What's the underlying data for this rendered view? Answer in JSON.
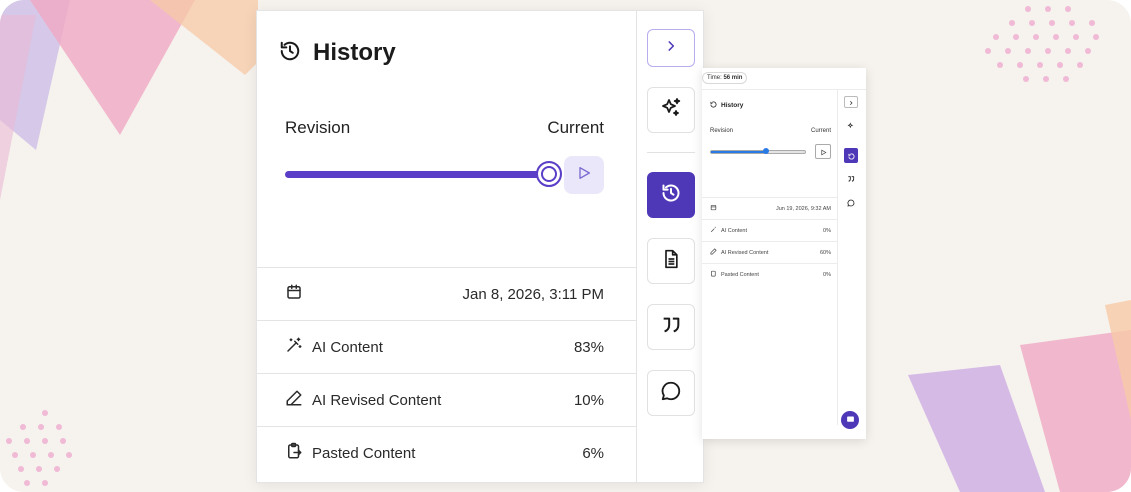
{
  "main": {
    "title": "History",
    "revision_label": "Revision",
    "current_label": "Current",
    "slider_position": 1.0,
    "stats": [
      {
        "icon": "calendar-icon",
        "label": "",
        "value": "Jan 8, 2026, 3:11 PM"
      },
      {
        "icon": "magic-wand-icon",
        "label": "AI Content",
        "value": "83%"
      },
      {
        "icon": "pencil-icon",
        "label": "AI Revised Content",
        "value": "10%"
      },
      {
        "icon": "clipboard-paste-icon",
        "label": "Pasted Content",
        "value": "6%"
      }
    ],
    "rail": [
      {
        "icon": "chevron-right-icon",
        "active": false
      },
      {
        "icon": "sparkles-icon",
        "active": false
      },
      {
        "icon": "history-icon",
        "active": true
      },
      {
        "icon": "document-icon",
        "active": false
      },
      {
        "icon": "quote-icon",
        "active": false
      },
      {
        "icon": "chat-bubble-icon",
        "active": false
      }
    ]
  },
  "mini": {
    "time_label": "Time:",
    "time_value": "56 min",
    "title": "History",
    "revision_label": "Revision",
    "current_label": "Current",
    "slider_position": 0.58,
    "stats": [
      {
        "icon": "calendar-icon",
        "label": "",
        "value": "Jun 19, 2026, 9:32 AM"
      },
      {
        "icon": "magic-wand-icon",
        "label": "AI Content",
        "value": "0%"
      },
      {
        "icon": "pencil-icon",
        "label": "AI Revised Content",
        "value": "60%"
      },
      {
        "icon": "clipboard-paste-icon",
        "label": "Pasted Content",
        "value": "0%"
      }
    ]
  },
  "colors": {
    "accent": "#4f38b8",
    "slider": "#5a3ec8",
    "play_bg": "#ebe7fb",
    "background": "#f6f2ed"
  }
}
